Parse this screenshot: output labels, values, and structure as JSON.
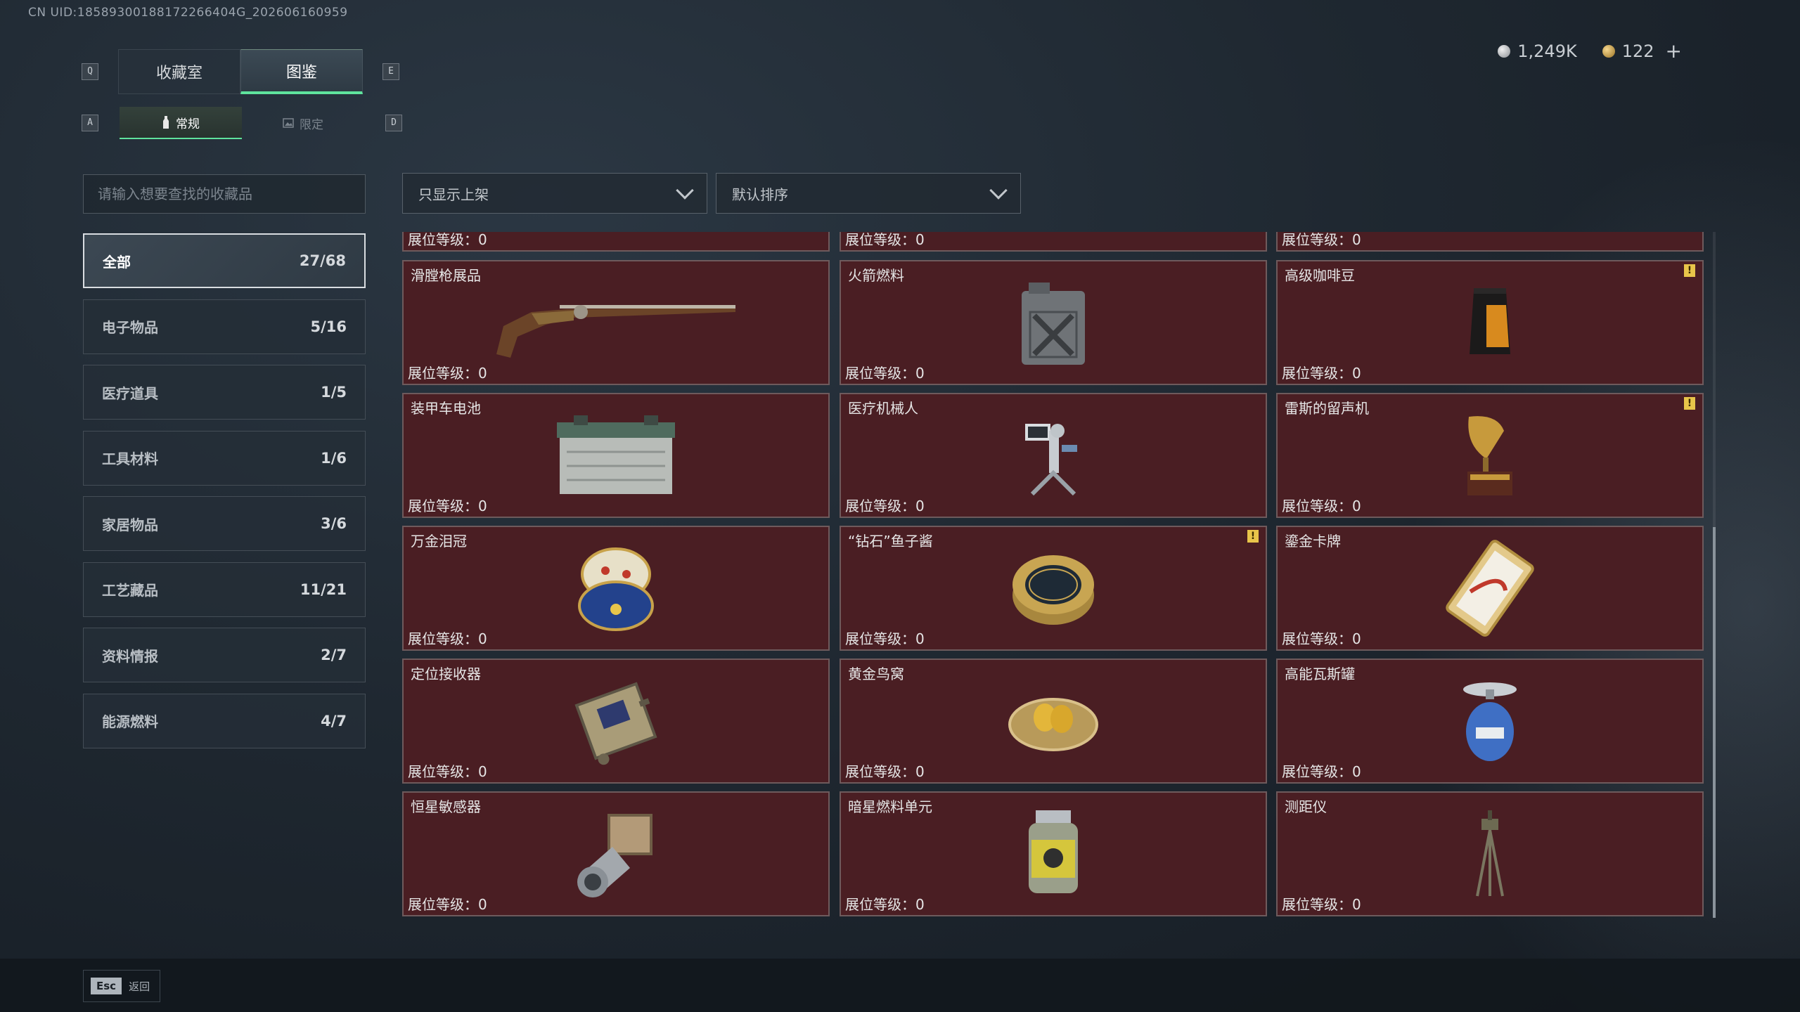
{
  "uid_text": "CN UID:18589300188172266404G_202606160959",
  "currency": {
    "silver": "1,249K",
    "gold": "122",
    "plus": "+"
  },
  "keys": {
    "prev_tab": "Q",
    "next_tab": "E",
    "prev_sub": "A",
    "next_sub": "D"
  },
  "tabs": [
    {
      "label": "收藏室",
      "active": false
    },
    {
      "label": "图鉴",
      "active": true
    }
  ],
  "subtabs": [
    {
      "label": "常规",
      "active": true
    },
    {
      "label": "限定",
      "active": false
    }
  ],
  "search": {
    "placeholder": "请输入想要查找的收藏品"
  },
  "categories": [
    {
      "label": "全部",
      "count": "27/68",
      "active": true
    },
    {
      "label": "电子物品",
      "count": "5/16",
      "active": false
    },
    {
      "label": "医疗道具",
      "count": "1/5",
      "active": false
    },
    {
      "label": "工具材料",
      "count": "1/6",
      "active": false
    },
    {
      "label": "家居物品",
      "count": "3/6",
      "active": false
    },
    {
      "label": "工艺藏品",
      "count": "11/21",
      "active": false
    },
    {
      "label": "资料情报",
      "count": "2/7",
      "active": false
    },
    {
      "label": "能源燃料",
      "count": "4/7",
      "active": false
    }
  ],
  "filters": {
    "shelf": "只显示上架",
    "sort": "默认排序"
  },
  "level_label": "展位等级：",
  "partial_row": [
    "0",
    "0",
    "0"
  ],
  "items": [
    {
      "name": "滑膛枪展品",
      "level": "0",
      "warn": false,
      "icon": "musket-icon"
    },
    {
      "name": "火箭燃料",
      "level": "0",
      "warn": false,
      "icon": "fuel-can-icon"
    },
    {
      "name": "高级咖啡豆",
      "level": "0",
      "warn": true,
      "icon": "coffee-bag-icon"
    },
    {
      "name": "装甲车电池",
      "level": "0",
      "warn": false,
      "icon": "battery-icon"
    },
    {
      "name": "医疗机械人",
      "level": "0",
      "warn": false,
      "icon": "medical-robot-icon"
    },
    {
      "name": "雷斯的留声机",
      "level": "0",
      "warn": true,
      "icon": "gramophone-icon"
    },
    {
      "name": "万金泪冠",
      "level": "0",
      "warn": false,
      "icon": "jeweled-egg-icon"
    },
    {
      "name": "“钻石”鱼子酱",
      "level": "0",
      "warn": true,
      "icon": "caviar-tin-icon"
    },
    {
      "name": "鎏金卡牌",
      "level": "0",
      "warn": false,
      "icon": "gold-card-icon"
    },
    {
      "name": "定位接收器",
      "level": "0",
      "warn": false,
      "icon": "receiver-icon"
    },
    {
      "name": "黄金鸟窝",
      "level": "0",
      "warn": false,
      "icon": "golden-nest-icon"
    },
    {
      "name": "高能瓦斯罐",
      "level": "0",
      "warn": false,
      "icon": "gas-canister-icon"
    },
    {
      "name": "恒星敏感器",
      "level": "0",
      "warn": false,
      "icon": "star-sensor-icon"
    },
    {
      "name": "暗星燃料单元",
      "level": "0",
      "warn": false,
      "icon": "fuel-cell-icon"
    },
    {
      "name": "测距仪",
      "level": "0",
      "warn": false,
      "icon": "rangefinder-icon"
    }
  ],
  "warn_glyph": "!",
  "footer": {
    "esc_key": "Esc",
    "esc_label": "返回"
  }
}
